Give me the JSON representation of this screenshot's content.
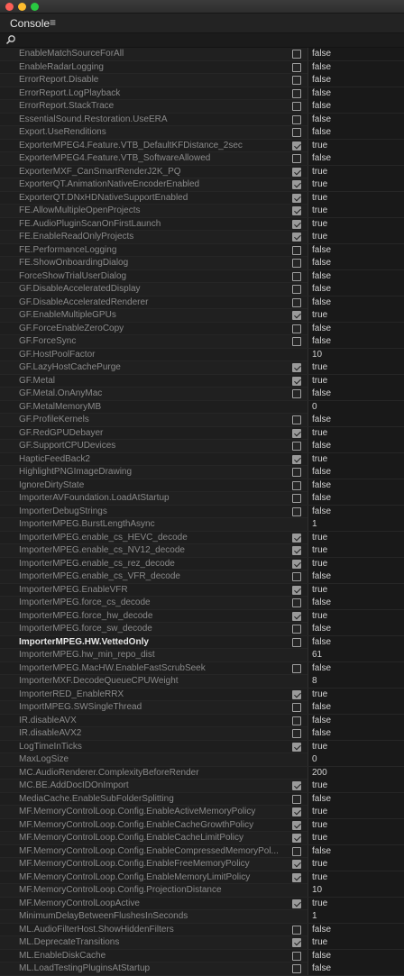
{
  "panel": {
    "title": "Console",
    "menu_icon": "hamburger-icon"
  },
  "search": {
    "icon": "search-icon"
  },
  "rows": [
    {
      "name": "EnableMatchSourceForAll",
      "checkbox": true,
      "checked": false,
      "value": "false"
    },
    {
      "name": "EnableRadarLogging",
      "checkbox": true,
      "checked": false,
      "value": "false"
    },
    {
      "name": "ErrorReport.Disable",
      "checkbox": true,
      "checked": false,
      "value": "false"
    },
    {
      "name": "ErrorReport.LogPlayback",
      "checkbox": true,
      "checked": false,
      "value": "false"
    },
    {
      "name": "ErrorReport.StackTrace",
      "checkbox": true,
      "checked": false,
      "value": "false"
    },
    {
      "name": "EssentialSound.Restoration.UseERA",
      "checkbox": true,
      "checked": false,
      "value": "false"
    },
    {
      "name": "Export.UseRenditions",
      "checkbox": true,
      "checked": false,
      "value": "false"
    },
    {
      "name": "ExporterMPEG4.Feature.VTB_DefaultKFDistance_2sec",
      "checkbox": true,
      "checked": true,
      "value": "true"
    },
    {
      "name": "ExporterMPEG4.Feature.VTB_SoftwareAllowed",
      "checkbox": true,
      "checked": false,
      "value": "false"
    },
    {
      "name": "ExporterMXF_CanSmartRenderJ2K_PQ",
      "checkbox": true,
      "checked": true,
      "value": "true"
    },
    {
      "name": "ExporterQT.AnimationNativeEncoderEnabled",
      "checkbox": true,
      "checked": true,
      "value": "true"
    },
    {
      "name": "ExporterQT.DNxHDNativeSupportEnabled",
      "checkbox": true,
      "checked": true,
      "value": "true"
    },
    {
      "name": "FE.AllowMultipleOpenProjects",
      "checkbox": true,
      "checked": true,
      "value": "true"
    },
    {
      "name": "FE.AudioPluginScanOnFirstLaunch",
      "checkbox": true,
      "checked": true,
      "value": "true"
    },
    {
      "name": "FE.EnableReadOnlyProjects",
      "checkbox": true,
      "checked": true,
      "value": "true"
    },
    {
      "name": "FE.PerformanceLogging",
      "checkbox": true,
      "checked": false,
      "value": "false"
    },
    {
      "name": "FE.ShowOnboardingDialog",
      "checkbox": true,
      "checked": false,
      "value": "false"
    },
    {
      "name": "ForceShowTrialUserDialog",
      "checkbox": true,
      "checked": false,
      "value": "false"
    },
    {
      "name": "GF.DisableAcceleratedDisplay",
      "checkbox": true,
      "checked": false,
      "value": "false"
    },
    {
      "name": "GF.DisableAcceleratedRenderer",
      "checkbox": true,
      "checked": false,
      "value": "false"
    },
    {
      "name": "GF.EnableMultipleGPUs",
      "checkbox": true,
      "checked": true,
      "value": "true"
    },
    {
      "name": "GF.ForceEnableZeroCopy",
      "checkbox": true,
      "checked": false,
      "value": "false"
    },
    {
      "name": "GF.ForceSync",
      "checkbox": true,
      "checked": false,
      "value": "false"
    },
    {
      "name": "GF.HostPoolFactor",
      "checkbox": false,
      "checked": false,
      "value": "10"
    },
    {
      "name": "GF.LazyHostCachePurge",
      "checkbox": true,
      "checked": true,
      "value": "true"
    },
    {
      "name": "GF.Metal",
      "checkbox": true,
      "checked": true,
      "value": "true"
    },
    {
      "name": "GF.Metal.OnAnyMac",
      "checkbox": true,
      "checked": false,
      "value": "false"
    },
    {
      "name": "GF.MetalMemoryMB",
      "checkbox": false,
      "checked": false,
      "value": "0"
    },
    {
      "name": "GF.ProfileKernels",
      "checkbox": true,
      "checked": false,
      "value": "false"
    },
    {
      "name": "GF.RedGPUDebayer",
      "checkbox": true,
      "checked": true,
      "value": "true"
    },
    {
      "name": "GF.SupportCPUDevices",
      "checkbox": true,
      "checked": false,
      "value": "false"
    },
    {
      "name": "HapticFeedBack2",
      "checkbox": true,
      "checked": true,
      "value": "true"
    },
    {
      "name": "HighlightPNGImageDrawing",
      "checkbox": true,
      "checked": false,
      "value": "false"
    },
    {
      "name": "IgnoreDirtyState",
      "checkbox": true,
      "checked": false,
      "value": "false"
    },
    {
      "name": "ImporterAVFoundation.LoadAtStartup",
      "checkbox": true,
      "checked": false,
      "value": "false"
    },
    {
      "name": "ImporterDebugStrings",
      "checkbox": true,
      "checked": false,
      "value": "false"
    },
    {
      "name": "ImporterMPEG.BurstLengthAsync",
      "checkbox": false,
      "checked": false,
      "value": "1"
    },
    {
      "name": "ImporterMPEG.enable_cs_HEVC_decode",
      "checkbox": true,
      "checked": true,
      "value": "true"
    },
    {
      "name": "ImporterMPEG.enable_cs_NV12_decode",
      "checkbox": true,
      "checked": true,
      "value": "true"
    },
    {
      "name": "ImporterMPEG.enable_cs_rez_decode",
      "checkbox": true,
      "checked": true,
      "value": "true"
    },
    {
      "name": "ImporterMPEG.enable_cs_VFR_decode",
      "checkbox": true,
      "checked": false,
      "value": "false"
    },
    {
      "name": "ImporterMPEG.EnableVFR",
      "checkbox": true,
      "checked": true,
      "value": "true"
    },
    {
      "name": "ImporterMPEG.force_cs_decode",
      "checkbox": true,
      "checked": false,
      "value": "false"
    },
    {
      "name": "ImporterMPEG.force_hw_decode",
      "checkbox": true,
      "checked": true,
      "value": "true"
    },
    {
      "name": "ImporterMPEG.force_sw_decode",
      "checkbox": true,
      "checked": false,
      "value": "false"
    },
    {
      "name": "ImporterMPEG.HW.VettedOnly",
      "checkbox": true,
      "checked": false,
      "value": "false",
      "bold": true
    },
    {
      "name": "ImporterMPEG.hw_min_repo_dist",
      "checkbox": false,
      "checked": false,
      "value": "61"
    },
    {
      "name": "ImporterMPEG.MacHW.EnableFastScrubSeek",
      "checkbox": true,
      "checked": false,
      "value": "false"
    },
    {
      "name": "ImporterMXF.DecodeQueueCPUWeight",
      "checkbox": false,
      "checked": false,
      "value": "8"
    },
    {
      "name": "ImporterRED_EnableRRX",
      "checkbox": true,
      "checked": true,
      "value": "true"
    },
    {
      "name": "ImportMPEG.SWSingleThread",
      "checkbox": true,
      "checked": false,
      "value": "false"
    },
    {
      "name": "IR.disableAVX",
      "checkbox": true,
      "checked": false,
      "value": "false"
    },
    {
      "name": "IR.disableAVX2",
      "checkbox": true,
      "checked": false,
      "value": "false"
    },
    {
      "name": "LogTimeInTicks",
      "checkbox": true,
      "checked": true,
      "value": "true"
    },
    {
      "name": "MaxLogSize",
      "checkbox": false,
      "checked": false,
      "value": "0"
    },
    {
      "name": "MC.AudioRenderer.ComplexityBeforeRender",
      "checkbox": false,
      "checked": false,
      "value": "200"
    },
    {
      "name": "MC.BE.AddDocIDOnImport",
      "checkbox": true,
      "checked": true,
      "value": "true"
    },
    {
      "name": "MediaCache.EnableSubFolderSplitting",
      "checkbox": true,
      "checked": false,
      "value": "false"
    },
    {
      "name": "MF.MemoryControlLoop.Config.EnableActiveMemoryPolicy",
      "checkbox": true,
      "checked": true,
      "value": "true"
    },
    {
      "name": "MF.MemoryControlLoop.Config.EnableCacheGrowthPolicy",
      "checkbox": true,
      "checked": true,
      "value": "true"
    },
    {
      "name": "MF.MemoryControlLoop.Config.EnableCacheLimitPolicy",
      "checkbox": true,
      "checked": true,
      "value": "true"
    },
    {
      "name": "MF.MemoryControlLoop.Config.EnableCompressedMemoryPol...",
      "checkbox": true,
      "checked": false,
      "value": "false"
    },
    {
      "name": "MF.MemoryControlLoop.Config.EnableFreeMemoryPolicy",
      "checkbox": true,
      "checked": true,
      "value": "true"
    },
    {
      "name": "MF.MemoryControlLoop.Config.EnableMemoryLimitPolicy",
      "checkbox": true,
      "checked": true,
      "value": "true"
    },
    {
      "name": "MF.MemoryControlLoop.Config.ProjectionDistance",
      "checkbox": false,
      "checked": false,
      "value": "10"
    },
    {
      "name": "MF.MemoryControlLoopActive",
      "checkbox": true,
      "checked": true,
      "value": "true"
    },
    {
      "name": "MinimumDelayBetweenFlushesInSeconds",
      "checkbox": false,
      "checked": false,
      "value": "1"
    },
    {
      "name": "ML.AudioFilterHost.ShowHiddenFilters",
      "checkbox": true,
      "checked": false,
      "value": "false"
    },
    {
      "name": "ML.DeprecateTransitions",
      "checkbox": true,
      "checked": true,
      "value": "true"
    },
    {
      "name": "ML.EnableDiskCache",
      "checkbox": true,
      "checked": false,
      "value": "false"
    },
    {
      "name": "ML.LoadTestingPluginsAtStartup",
      "checkbox": true,
      "checked": false,
      "value": "false"
    }
  ]
}
